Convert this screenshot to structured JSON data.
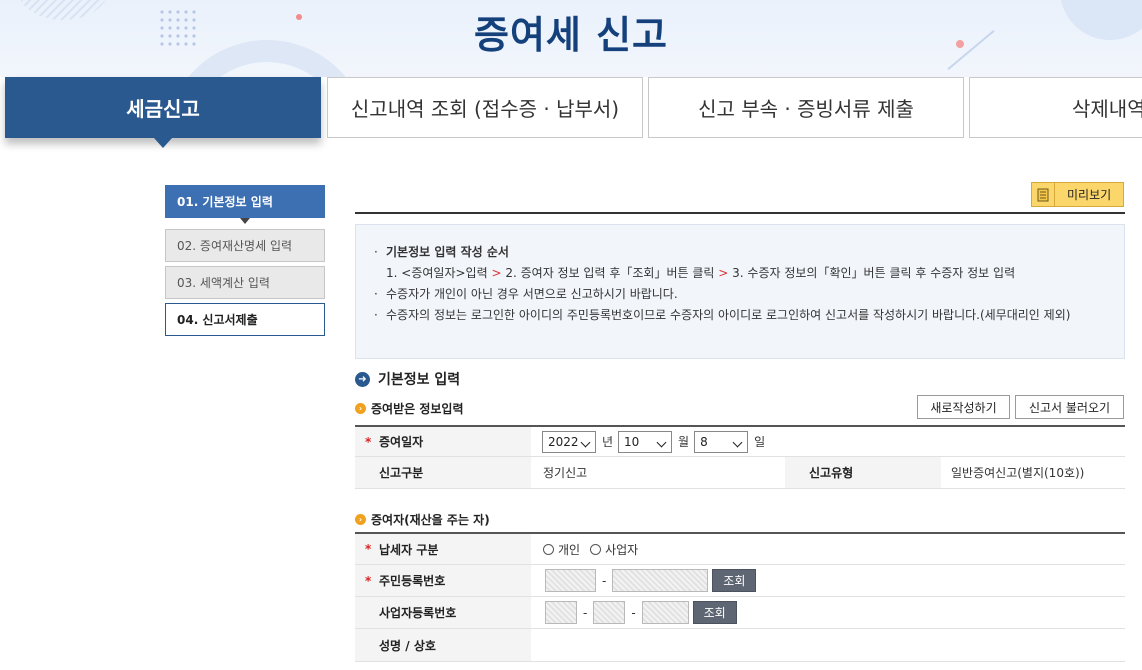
{
  "page": {
    "title": "증여세 신고"
  },
  "tabs": [
    {
      "label": "세금신고",
      "active": true
    },
    {
      "label": "신고내역 조회 (접수증 · 납부서)",
      "active": false
    },
    {
      "label": "신고 부속 · 증빙서류 제출",
      "active": false
    },
    {
      "label": "삭제내역",
      "active": false
    }
  ],
  "steps": [
    {
      "label": "01. 기본정보 입력",
      "state": "active"
    },
    {
      "label": "02. 증여재산명세 입력",
      "state": "inactive"
    },
    {
      "label": "03. 세액계산 입력",
      "state": "inactive"
    },
    {
      "label": "04. 신고서제출",
      "state": "highlight"
    }
  ],
  "toolbar": {
    "preview_label": "미리보기",
    "preview_icon": "document-icon"
  },
  "notice": {
    "heading": "기본정보 입력 작성 순서",
    "order": {
      "step1": "1. <증여일자>입력",
      "step2": "2. 증여자 정보 입력 후「조회」버튼 클릭",
      "step3": "3. 수증자 정보의「확인」버튼 클릭 후 수증자 정보 입력",
      "sep": ">"
    },
    "line2": "수증자가 개인이 아닌 경우 서면으로 신고하시기 바랍니다.",
    "line3": "수증자의 정보는 로그인한 아이디의 주민등록번호이므로 수증자의 아이디로 로그인하여 신고서를 작성하시기 바랍니다.(세무대리인 제외)"
  },
  "section": {
    "title": "기본정보 입력",
    "received": {
      "title": "증여받은 정보입력",
      "new_button": "새로작성하기",
      "load_button": "신고서 불러오기",
      "date_label": "증여일자",
      "year": "2022",
      "year_unit": "년",
      "month": "10",
      "month_unit": "월",
      "day": "8",
      "day_unit": "일",
      "type_label": "신고구분",
      "type_value": "정기신고",
      "kind_label": "신고유형",
      "kind_value": "일반증여신고(별지(10호))"
    },
    "donor": {
      "title": "증여자(재산을 주는 자)",
      "taxpayer_label": "납세자 구분",
      "opt_individual": "개인",
      "opt_business": "사업자",
      "rrn_label": "주민등록번호",
      "lookup": "조회",
      "brn_label": "사업자등록번호",
      "name_label": "성명 / 상호",
      "dash": "-"
    },
    "required_mark": "*"
  },
  "colors": {
    "primary": "#2a5990",
    "title": "#14407b",
    "preview": "#fbd66a",
    "required": "#d22222"
  }
}
